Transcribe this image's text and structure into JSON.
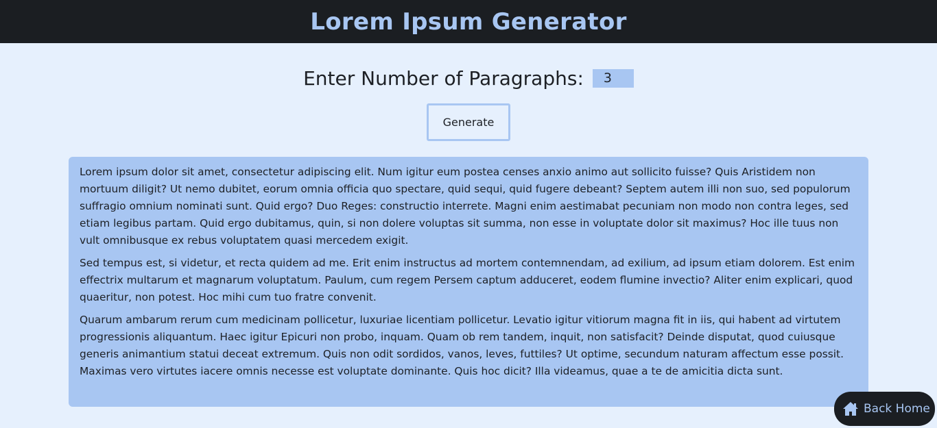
{
  "header": {
    "title": "Lorem Ipsum Generator"
  },
  "controls": {
    "label": "Enter Number of Paragraphs:",
    "paragraph_count": "3",
    "generate_label": "Generate"
  },
  "output": {
    "paragraphs": [
      "Lorem ipsum dolor sit amet, consectetur adipiscing elit. Num igitur eum postea censes anxio animo aut sollicito fuisse? Quis Aristidem non mortuum diligit? Ut nemo dubitet, eorum omnia officia quo spectare, quid sequi, quid fugere debeant? Septem autem illi non suo, sed populorum suffragio omnium nominati sunt. Quid ergo? Duo Reges: constructio interrete. Magni enim aestimabat pecuniam non modo non contra leges, sed etiam legibus partam. Quid ergo dubitamus, quin, si non dolere voluptas sit summa, non esse in voluptate dolor sit maximus? Hoc ille tuus non vult omnibusque ex rebus voluptatem quasi mercedem exigit.",
      "Sed tempus est, si videtur, et recta quidem ad me. Erit enim instructus ad mortem contemnendam, ad exilium, ad ipsum etiam dolorem. Est enim effectrix multarum et magnarum voluptatum. Paulum, cum regem Persem captum adduceret, eodem flumine invectio? Aliter enim explicari, quod quaeritur, non potest. Hoc mihi cum tuo fratre convenit.",
      "Quarum ambarum rerum cum medicinam pollicetur, luxuriae licentiam pollicetur. Levatio igitur vitiorum magna fit in iis, qui habent ad virtutem progressionis aliquantum. Haec igitur Epicuri non probo, inquam. Quam ob rem tandem, inquit, non satisfacit? Deinde disputat, quod cuiusque generis animantium statui deceat extremum. Quis non odit sordidos, vanos, leves, futtiles? Ut optime, secundum naturam affectum esse possit. Maximas vero virtutes iacere omnis necesse est voluptate dominante. Quis hoc dicit? Illa videamus, quae a te de amicitia dicta sunt."
    ]
  },
  "back_home": {
    "label": "Back Home",
    "icon": "home-icon"
  },
  "colors": {
    "header_bg": "#1b1e22",
    "accent": "#a8c6f2",
    "page_bg": "#e6f0fd"
  }
}
